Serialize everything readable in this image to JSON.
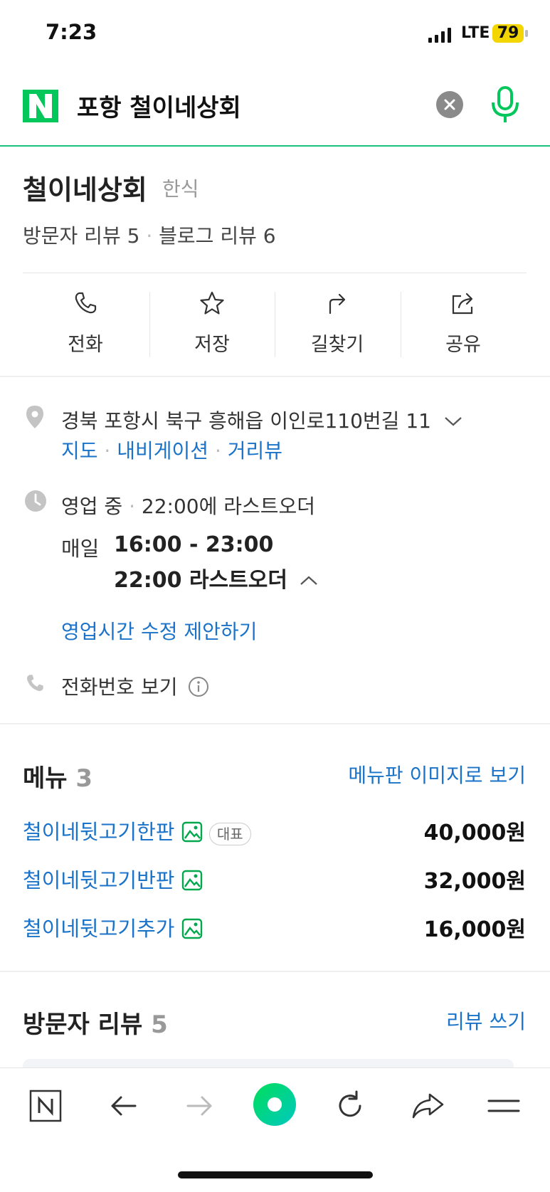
{
  "status_bar": {
    "time": "7:23",
    "network": "LTE",
    "battery": "79"
  },
  "search": {
    "logo": "N",
    "query": "포항 철이네상회"
  },
  "place": {
    "name": "철이네상회",
    "category": "한식",
    "visitor_reviews": "방문자 리뷰 5",
    "blog_reviews": "블로그 리뷰 6"
  },
  "actions": [
    {
      "label": "전화",
      "icon": "phone-icon"
    },
    {
      "label": "저장",
      "icon": "star-icon"
    },
    {
      "label": "길찾기",
      "icon": "directions-icon"
    },
    {
      "label": "공유",
      "icon": "share-icon"
    }
  ],
  "info": {
    "address": "경북 포항시 북구 흥해읍 이인로110번길 11",
    "address_links": [
      "지도",
      "내비게이션",
      "거리뷰"
    ],
    "status": "영업 중",
    "last_order_note": "22:00에 라스트오더",
    "schedule_day": "매일",
    "schedule_hours": "16:00 - 23:00",
    "schedule_last_order": "22:00 라스트오더",
    "suggest_edit": "영업시간 수정 제안하기",
    "phone_view": "전화번호 보기"
  },
  "menu": {
    "title": "메뉴",
    "count": "3",
    "link": "메뉴판 이미지로 보기",
    "items": [
      {
        "name": "철이네뒷고기한판",
        "badge": "대표",
        "price": "40,000원"
      },
      {
        "name": "철이네뒷고기반판",
        "price": "32,000원"
      },
      {
        "name": "철이네뒷고기추가",
        "price": "16,000원"
      }
    ]
  },
  "visitor_review_section": {
    "title": "방문자 리뷰",
    "count": "5",
    "link": "리뷰 쓰기"
  },
  "colors": {
    "naver_green": "#03c75a",
    "link_blue": "#1a73c8"
  }
}
